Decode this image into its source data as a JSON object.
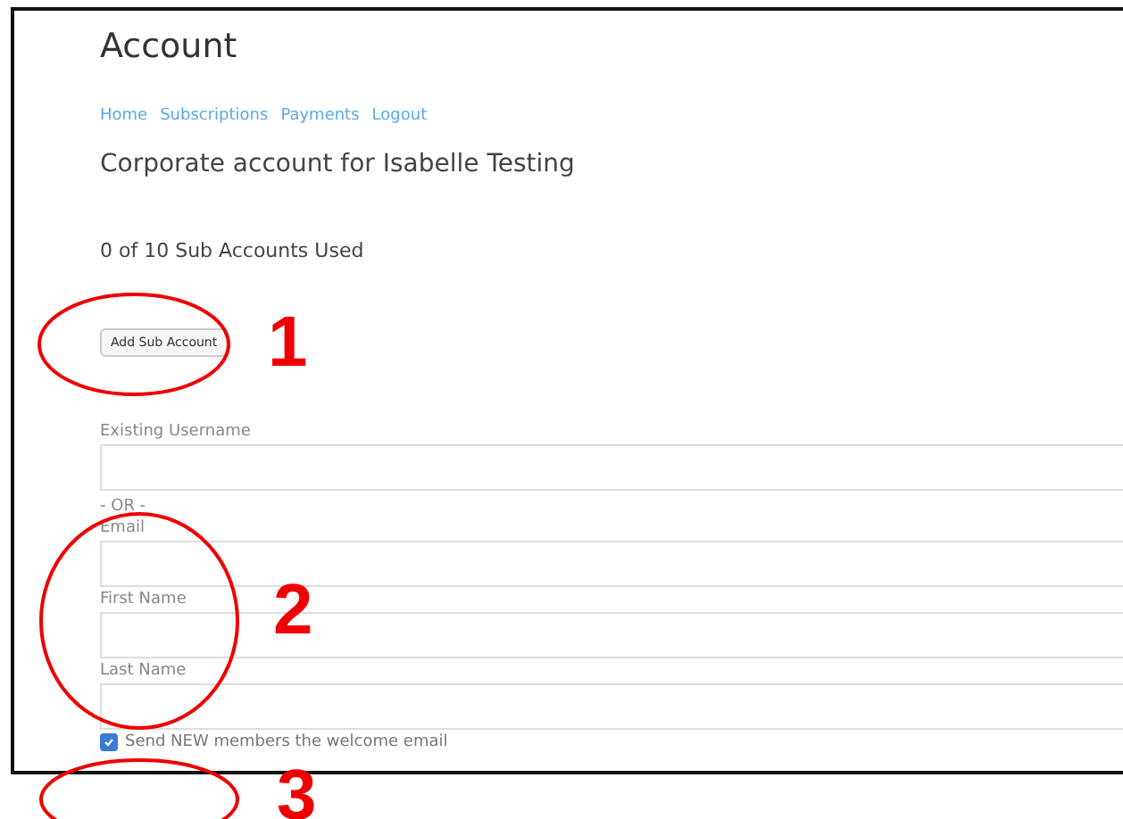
{
  "page_title": "Account",
  "nav_links": [
    {
      "label": "Home"
    },
    {
      "label": "Subscriptions"
    },
    {
      "label": "Payments"
    },
    {
      "label": "Logout"
    }
  ],
  "account_heading": "Corporate account for Isabelle Testing",
  "usage": "0 of 10 Sub Accounts Used",
  "add_button": "Add Sub Account",
  "fields": [
    {
      "kind": "field",
      "label": "Existing Username"
    },
    {
      "kind": "separator",
      "label": "- OR -"
    },
    {
      "kind": "field",
      "label": "Email"
    },
    {
      "kind": "field",
      "label": "First Name"
    },
    {
      "kind": "field",
      "label": "Last Name"
    }
  ],
  "welcome_checkbox": {
    "label": "Send NEW members the welcome email",
    "checked": true
  },
  "annotations": [
    {
      "number": "1"
    },
    {
      "number": "2"
    },
    {
      "number": "3"
    }
  ]
}
